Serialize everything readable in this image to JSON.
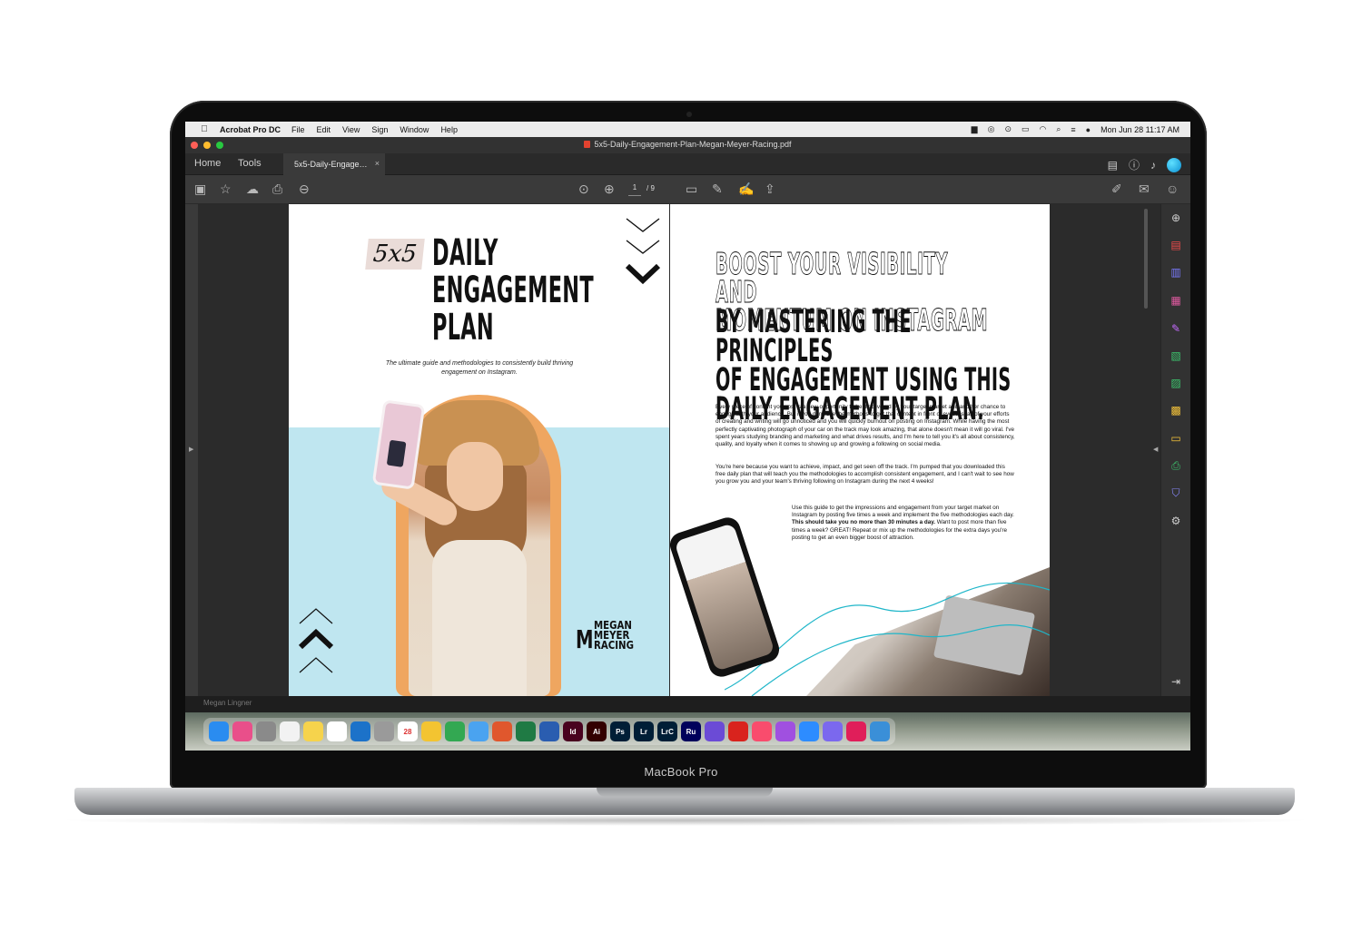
{
  "device": {
    "model_label": "MacBook Pro"
  },
  "menubar": {
    "app_name": "Acrobat Pro DC",
    "menus": [
      "File",
      "Edit",
      "View",
      "Sign",
      "Window",
      "Help"
    ],
    "clock": "Mon Jun 28  11:17 AM"
  },
  "window": {
    "title": "5x5-Daily-Engagement-Plan-Megan-Meyer-Racing.pdf"
  },
  "tabs": {
    "home": "Home",
    "tools": "Tools",
    "document": "5x5-Daily-Engage…",
    "close": "×"
  },
  "toolbar": {
    "page_current": "1",
    "page_total": "/ 9"
  },
  "colors": {
    "accent": "#2ec4f0",
    "blue_bg": "#bfe6f0",
    "orange_outline": "#efa660"
  },
  "left_page": {
    "badge": "5x5",
    "title_lines": [
      "DAILY",
      "ENGAGEMENT",
      "PLAN"
    ],
    "subtitle_line1": "The ultimate guide and methodologies to consistently build thriving",
    "subtitle_line2": "engagement on Instagram.",
    "logo_mark": "M",
    "logo_lines": [
      "MEGAN",
      "MEYER",
      "RACING"
    ]
  },
  "right_page": {
    "outline_heading": [
      "BOOST YOUR VISIBILITY AND",
      "MOMENTUM ON INSTAGRAM"
    ],
    "solid_heading": [
      "BY MASTERING THE PRINCIPLES",
      "OF ENGAGEMENT USING THIS",
      "DAILY ENGAGEMENT PLAN."
    ],
    "para1": "Every piece of content you post is a new opportunity to be discovered by your target market and another chance to engage with your audience. But if you don't use the methods to get that content in front of eyeballs, all of your efforts of creating and writing will go unnoticed and you will quickly burnout on posting on Instagram. While having the most perfectly captivating photograph of your car on the track may look amazing, that alone doesn't mean it will go viral. I've spent years studying branding and marketing and what drives results, and I'm here to tell you it's all about consistency, quality, and loyalty when it comes to showing up and growing a following on social media.",
    "para2": "You're here because you want to achieve, impact, and get seen off the track. I'm pumped that you downloaded this free daily plan that will teach you the methodologies to accomplish consistent engagement, and I can't wait to see how you grow you and your team's thriving following on Instagram during the next 4 weeks!",
    "para3_a": "Use this guide to get the impressions and engagement from your target market on Instagram by posting five times a week and implement the five methodologies each day. ",
    "para3_bold": "This should take you no more than 30 minutes a day.",
    "para3_b": " Want to post more than five times a week? GREAT! Repeat or mix up the methodologies for the extra days you're posting to get an even bigger boost of attraction."
  },
  "under_strip": {
    "user": "Megan Lingner"
  },
  "dock": {
    "apps": [
      {
        "label": "",
        "color": "#2a8cf0"
      },
      {
        "label": "",
        "color": "#e94f8a"
      },
      {
        "label": "",
        "color": "#8a8a8a"
      },
      {
        "label": "",
        "color": "#f2f2f2"
      },
      {
        "label": "",
        "color": "#f6d34c"
      },
      {
        "label": "",
        "color": "#ffffff"
      },
      {
        "label": "",
        "color": "#1c72c9"
      },
      {
        "label": "",
        "color": "#9a9a9a"
      },
      {
        "label": "28",
        "color": "#ffffff"
      },
      {
        "label": "",
        "color": "#f3c431"
      },
      {
        "label": "",
        "color": "#33a852"
      },
      {
        "label": "",
        "color": "#4aa3f0"
      },
      {
        "label": "",
        "color": "#e0572d"
      },
      {
        "label": "",
        "color": "#1f7a44"
      },
      {
        "label": "",
        "color": "#2a5db0"
      },
      {
        "label": "Id",
        "color": "#49021f"
      },
      {
        "label": "Ai",
        "color": "#330000"
      },
      {
        "label": "Ps",
        "color": "#001e36"
      },
      {
        "label": "Lr",
        "color": "#001e36"
      },
      {
        "label": "LrC",
        "color": "#001e36"
      },
      {
        "label": "Ru",
        "color": "#00005b"
      },
      {
        "label": "",
        "color": "#6b4bd6"
      },
      {
        "label": "",
        "color": "#d9231d"
      },
      {
        "label": "",
        "color": "#f94c6d"
      },
      {
        "label": "",
        "color": "#a050e0"
      },
      {
        "label": "",
        "color": "#2d8cff"
      },
      {
        "label": "",
        "color": "#7b68ee"
      },
      {
        "label": "",
        "color": "#e01e5a"
      },
      {
        "label": "",
        "color": "#3a8fd8"
      }
    ]
  }
}
